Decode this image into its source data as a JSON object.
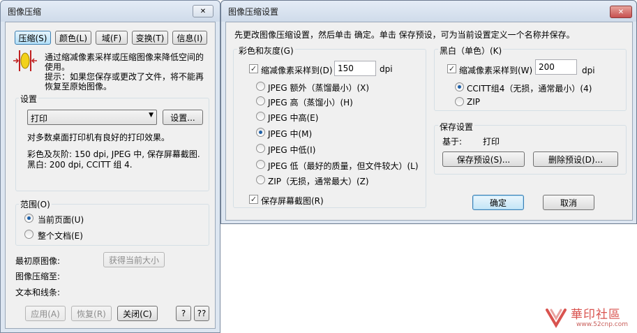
{
  "left_window": {
    "title": "图像压缩",
    "close_label": "✕",
    "tabs": [
      {
        "label": "压缩(S)"
      },
      {
        "label": "颜色(L)"
      },
      {
        "label": "域(F)"
      },
      {
        "label": "变换(T)"
      },
      {
        "label": "信息(I)"
      }
    ],
    "description": [
      "通过缩减像素采样或压缩图像来降低空间的",
      "使用。"
    ],
    "hint": [
      "提示：如果您保存或更改了文件，将不能再",
      "恢复至原始图像。"
    ],
    "settings": {
      "label": "设置",
      "selected": "打印",
      "settings_button": "设置...",
      "desc": "对多数桌面打印机有良好的打印效果。",
      "summary": [
        "彩色及灰阶: 150 dpi, JPEG 中, 保存屏幕截图.",
        "黑白: 200 dpi, CCITT 组 4."
      ]
    },
    "range": {
      "label": "范围(O)",
      "options": [
        {
          "label": "当前页面(U)",
          "checked": true
        },
        {
          "label": "整个文档(E)",
          "checked": false
        }
      ]
    },
    "original_size_label": "最初原图像:",
    "get_size_button": "获得当前大小",
    "compressed_label": "图像压缩至:",
    "text_lines_label": "文本和线条:",
    "apply_button": "应用(A)",
    "restore_button": "恢复(R)",
    "close_button": "关闭(C)",
    "help_button": "?",
    "help2_button": "??"
  },
  "right_window": {
    "title": "图像压缩设置",
    "close_label": "✕",
    "intro": "先更改图像压缩设置，然后单击 确定。单击 保存预设，可为当前设置定义一个名称并保存。",
    "color_gray": {
      "label": "彩色和灰度(G)",
      "downsample_label": "缩减像素采样到(D)",
      "downsample_checked": true,
      "dpi_value": "150",
      "dpi_unit": "dpi",
      "options": [
        {
          "label": "JPEG 额外（蒸馏最小）(X)",
          "checked": false
        },
        {
          "label": "JPEG 高（蒸馏小）(H)",
          "checked": false
        },
        {
          "label": "JPEG 中高(E)",
          "checked": false
        },
        {
          "label": "JPEG 中(M)",
          "checked": true
        },
        {
          "label": "JPEG 中低(I)",
          "checked": false
        },
        {
          "label": "JPEG 低（最好的质量，但文件较大）(L)",
          "checked": false
        },
        {
          "label": "ZIP（无损，通常最大）(Z)",
          "checked": false
        }
      ],
      "screenshot_label": "保存屏幕截图(R)",
      "screenshot_checked": true
    },
    "mono": {
      "label": "黑白（单色）(K)",
      "downsample_label": "缩减像素采样到(W)",
      "downsample_checked": true,
      "dpi_value": "200",
      "dpi_unit": "dpi",
      "options": [
        {
          "label": "CCITT组4（无损，通常最小）(4)",
          "checked": true
        },
        {
          "label": "ZIP",
          "checked": false
        }
      ]
    },
    "preset": {
      "label": "保存设置",
      "based_on_label": "基于:",
      "based_on_value": "打印",
      "save_button": "保存预设(S)...",
      "delete_button": "删除预设(D)..."
    },
    "ok_button": "确定",
    "cancel_button": "取消"
  },
  "watermark": {
    "text": "華印社區",
    "url": "www.52cnp.com"
  },
  "colors": {
    "title_close_red": "#c75050",
    "radio_dot": "#1d5fa7",
    "watermark_red": "#d9534f"
  }
}
